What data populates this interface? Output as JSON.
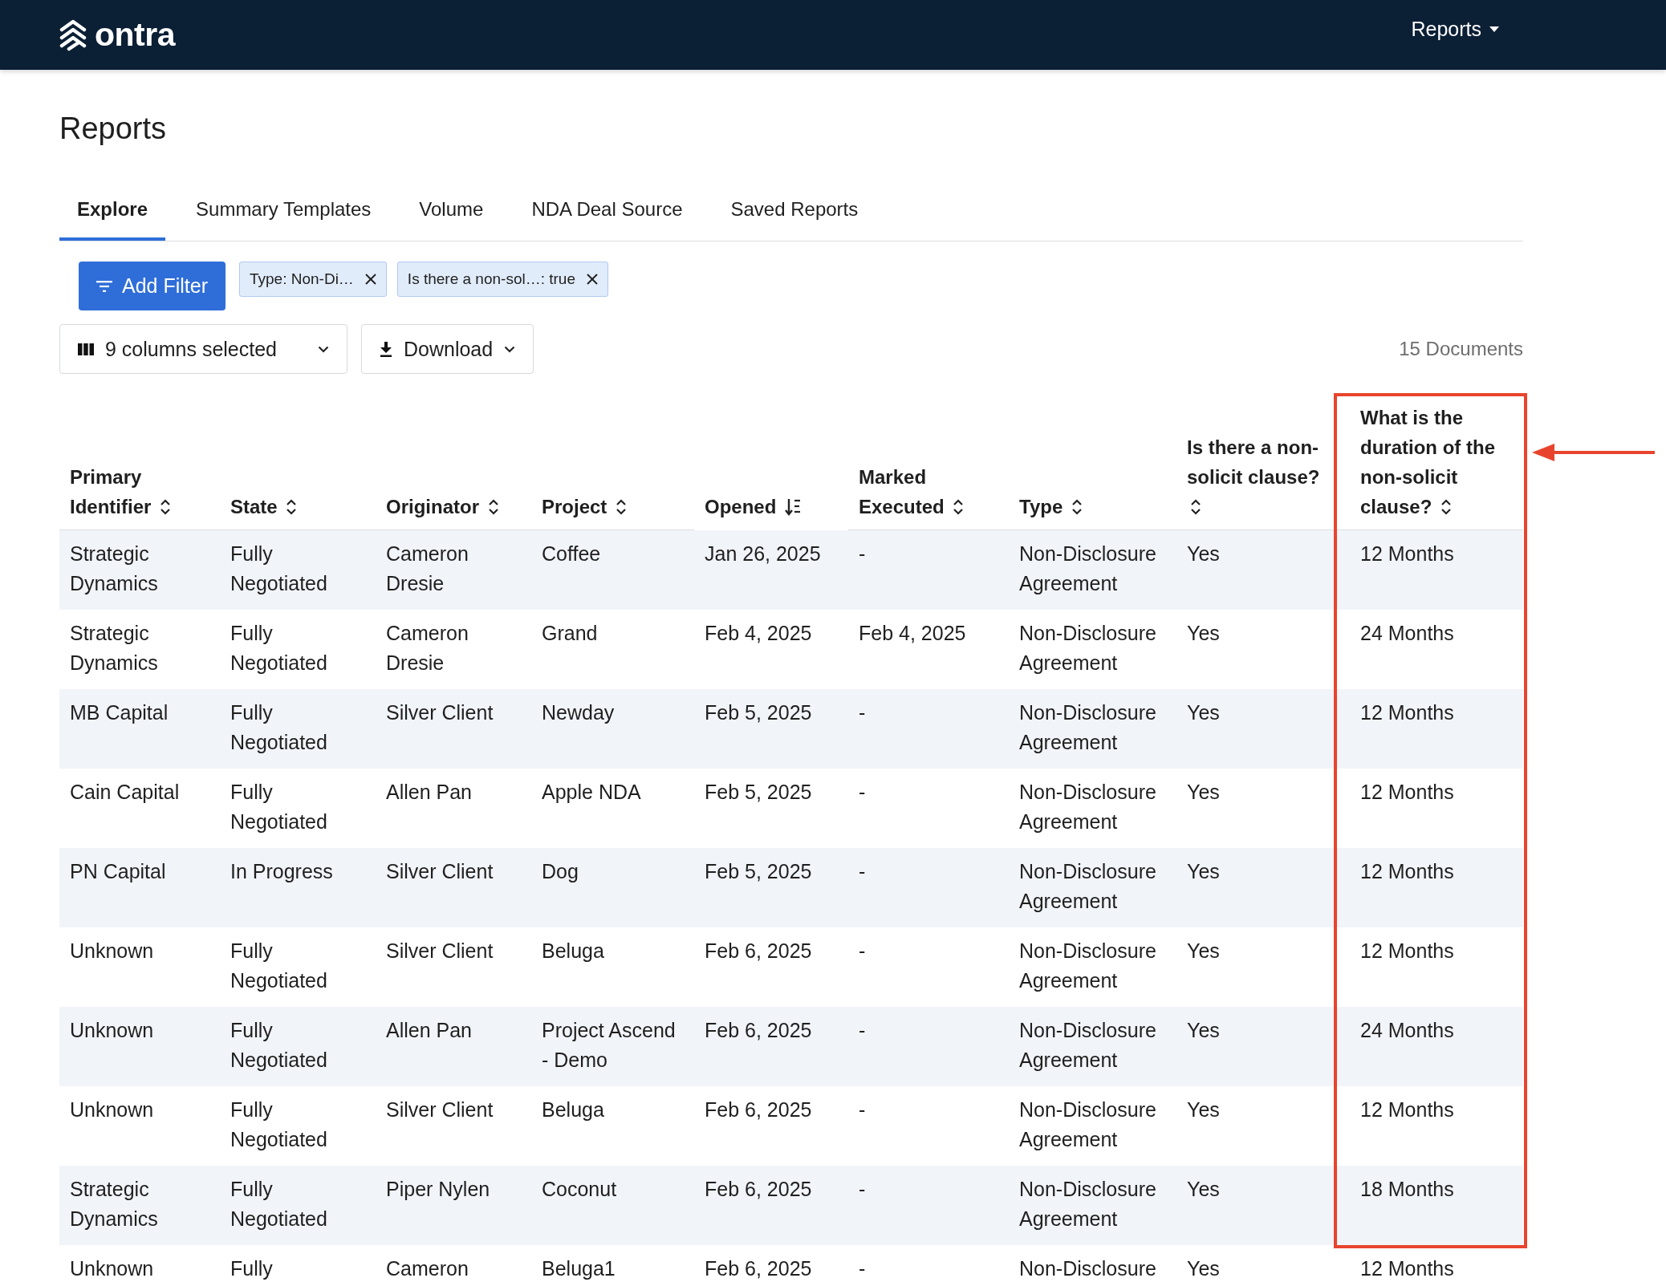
{
  "header": {
    "logo": "ontra",
    "menu": "Reports"
  },
  "title": "Reports",
  "tabs": [
    {
      "label": "Explore",
      "selected": true
    },
    {
      "label": "Summary Templates",
      "selected": false
    },
    {
      "label": "Volume",
      "selected": false
    },
    {
      "label": "NDA Deal Source",
      "selected": false
    },
    {
      "label": "Saved Reports",
      "selected": false
    }
  ],
  "filters": {
    "add_button": "Add Filter",
    "chips": [
      {
        "label": "Type: Non-Di…"
      },
      {
        "label": "Is there a non-sol…: true"
      }
    ]
  },
  "toolbar": {
    "columns_button": "9 columns selected",
    "download_button": "Download",
    "document_count": "15 Documents"
  },
  "table": {
    "columns": [
      {
        "label": "Primary Identifier",
        "sorted": false,
        "highlighted": false
      },
      {
        "label": "State",
        "sorted": false,
        "highlighted": false
      },
      {
        "label": "Originator",
        "sorted": false,
        "highlighted": false
      },
      {
        "label": "Project",
        "sorted": false,
        "highlighted": false
      },
      {
        "label": "Opened",
        "sorted": true,
        "highlighted": false
      },
      {
        "label": "Marked Executed",
        "sorted": false,
        "highlighted": false
      },
      {
        "label": "Type",
        "sorted": false,
        "highlighted": false
      },
      {
        "label": "Is there a non-solicit clause?",
        "sorted": false,
        "highlighted": false
      },
      {
        "label": "What is the duration of the non-solicit clause?",
        "sorted": false,
        "highlighted": true
      }
    ],
    "rows": [
      {
        "cells": [
          "Strategic Dynamics",
          "Fully Negotiated",
          "Cameron Dresie",
          "Coffee",
          "Jan 26, 2025",
          "-",
          "Non-Disclosure Agreement",
          "Yes",
          "12 Months"
        ]
      },
      {
        "cells": [
          "Strategic Dynamics",
          "Fully Negotiated",
          "Cameron Dresie",
          "Grand",
          "Feb 4, 2025",
          "Feb 4, 2025",
          "Non-Disclosure Agreement",
          "Yes",
          "24 Months"
        ]
      },
      {
        "cells": [
          "MB Capital",
          "Fully Negotiated",
          "Silver Client",
          "Newday",
          "Feb 5, 2025",
          "-",
          "Non-Disclosure Agreement",
          "Yes",
          "12 Months"
        ]
      },
      {
        "cells": [
          "Cain Capital",
          "Fully Negotiated",
          "Allen Pan",
          "Apple NDA",
          "Feb 5, 2025",
          "-",
          "Non-Disclosure Agreement",
          "Yes",
          "12 Months"
        ]
      },
      {
        "cells": [
          "PN Capital",
          "In Progress",
          "Silver Client",
          "Dog",
          "Feb 5, 2025",
          "-",
          "Non-Disclosure Agreement",
          "Yes",
          "12 Months"
        ]
      },
      {
        "cells": [
          "Unknown",
          "Fully Negotiated",
          "Silver Client",
          "Beluga",
          "Feb 6, 2025",
          "-",
          "Non-Disclosure Agreement",
          "Yes",
          "12 Months"
        ]
      },
      {
        "cells": [
          "Unknown",
          "Fully Negotiated",
          "Allen Pan",
          "Project Ascend - Demo",
          "Feb 6, 2025",
          "-",
          "Non-Disclosure Agreement",
          "Yes",
          "24 Months"
        ]
      },
      {
        "cells": [
          "Unknown",
          "Fully Negotiated",
          "Silver Client",
          "Beluga",
          "Feb 6, 2025",
          "-",
          "Non-Disclosure Agreement",
          "Yes",
          "12 Months"
        ]
      },
      {
        "cells": [
          "Strategic Dynamics",
          "Fully Negotiated",
          "Piper Nylen",
          "Coconut",
          "Feb 6, 2025",
          "-",
          "Non-Disclosure Agreement",
          "Yes",
          "18 Months"
        ]
      }
    ],
    "partial_row": {
      "cells": [
        "Unknown",
        "Fully",
        "Cameron",
        "Beluga1",
        "Feb 6, 2025",
        "-",
        "Non-Disclosure",
        "Yes",
        "12 Months"
      ]
    }
  }
}
